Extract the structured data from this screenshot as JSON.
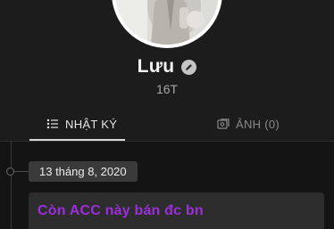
{
  "profile": {
    "name": "Lưu",
    "age": "16T"
  },
  "tabs": [
    {
      "label": "NHẬT KÝ",
      "icon": "list-icon",
      "active": true
    },
    {
      "label": "ẢNH (0)",
      "icon": "photo-icon",
      "active": false
    }
  ],
  "feed": {
    "entries": [
      {
        "date": "13 tháng 8, 2020",
        "text": "Còn ACC này bán đc bn",
        "text_color": "#9b2fd9"
      }
    ]
  },
  "colors": {
    "background": "#1c1c1c",
    "feed_background": "#141414",
    "active_tab": "#e6e6e6",
    "inactive_tab": "#8a8a8a",
    "post_text": "#9b2fd9"
  }
}
